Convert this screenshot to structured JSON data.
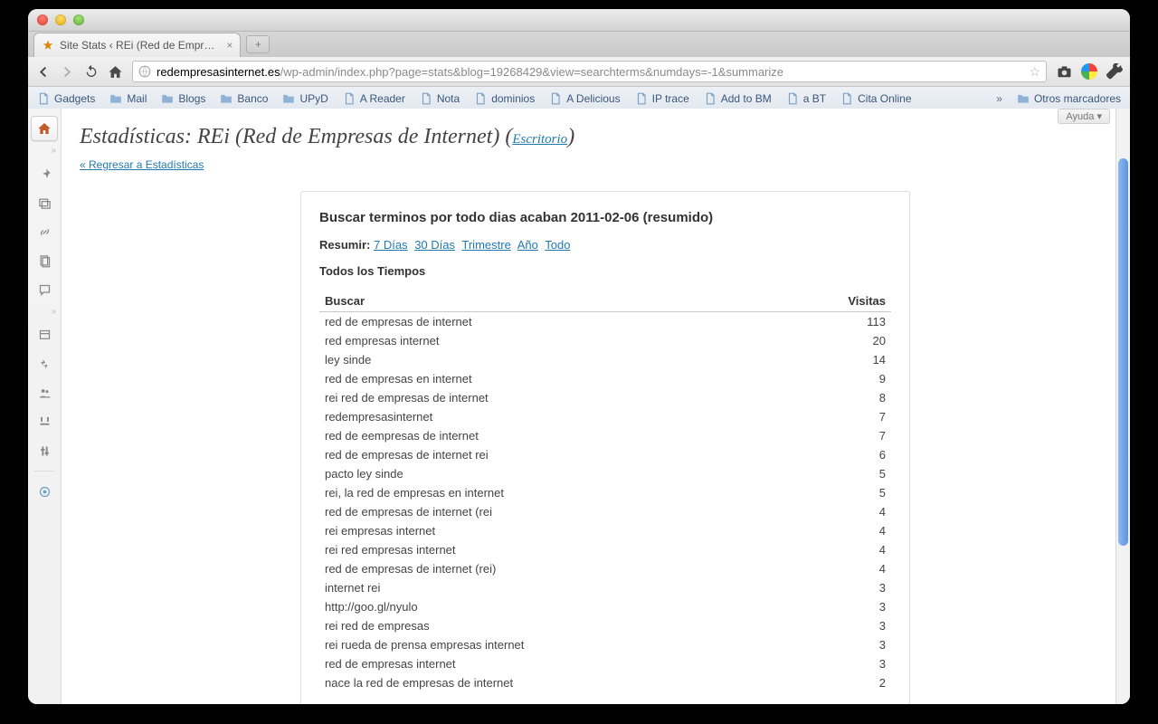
{
  "browser": {
    "tab_title": "Site Stats ‹ REi (Red de Empr…",
    "url_host": "redempresasinternet.es",
    "url_path": "/wp-admin/index.php?page=stats&blog=19268429&view=searchterms&numdays=-1&summarize",
    "bookmarks": [
      {
        "type": "page",
        "label": "Gadgets"
      },
      {
        "type": "folder",
        "label": "Mail"
      },
      {
        "type": "folder",
        "label": "Blogs"
      },
      {
        "type": "folder",
        "label": "Banco"
      },
      {
        "type": "folder",
        "label": "UPyD"
      },
      {
        "type": "page",
        "label": "A Reader"
      },
      {
        "type": "page",
        "label": "Nota"
      },
      {
        "type": "page",
        "label": "dominios"
      },
      {
        "type": "page",
        "label": "A Delicious"
      },
      {
        "type": "page",
        "label": "IP trace"
      },
      {
        "type": "page",
        "label": "Add to BM"
      },
      {
        "type": "page",
        "label": "a BT"
      },
      {
        "type": "page",
        "label": "Cita Online"
      }
    ],
    "otros_marcadores": "Otros marcadores"
  },
  "page": {
    "help": "Ayuda",
    "title_prefix": "Estadísticas: ",
    "title_main": "REi (Red de Empresas de Internet)",
    "title_link": "Escritorio",
    "back_link": "« Regresar a Estadísticas",
    "panel_heading": "Buscar terminos por todo dias acaban 2011-02-06 (resumido)",
    "resume_label": "Resumir:",
    "resume_links": [
      "7 Días",
      "30 Días",
      "Trimestre",
      "Año",
      "Todo"
    ],
    "subheading": "Todos los Tiempos",
    "col_search": "Buscar",
    "col_visits": "Visitas",
    "rows": [
      {
        "term": "red de empresas de internet",
        "visits": 113
      },
      {
        "term": "red empresas internet",
        "visits": 20
      },
      {
        "term": "ley sinde",
        "visits": 14
      },
      {
        "term": "red de empresas en internet",
        "visits": 9
      },
      {
        "term": "rei red de empresas de internet",
        "visits": 8
      },
      {
        "term": "redempresasinternet",
        "visits": 7
      },
      {
        "term": "red de eempresas de internet",
        "visits": 7
      },
      {
        "term": "red de empresas de internet rei",
        "visits": 6
      },
      {
        "term": "pacto ley sinde",
        "visits": 5
      },
      {
        "term": "rei, la red de empresas en internet",
        "visits": 5
      },
      {
        "term": "red de empresas de internet (rei",
        "visits": 4
      },
      {
        "term": "rei empresas internet",
        "visits": 4
      },
      {
        "term": "rei red empresas internet",
        "visits": 4
      },
      {
        "term": "red de empresas de internet (rei)",
        "visits": 4
      },
      {
        "term": "internet rei",
        "visits": 3
      },
      {
        "term": "http://goo.gl/nyulo",
        "visits": 3
      },
      {
        "term": "rei red de empresas",
        "visits": 3
      },
      {
        "term": "rei rueda de prensa empresas internet",
        "visits": 3
      },
      {
        "term": "red de empresas internet",
        "visits": 3
      },
      {
        "term": "nace la red de empresas de internet",
        "visits": 2
      }
    ]
  }
}
